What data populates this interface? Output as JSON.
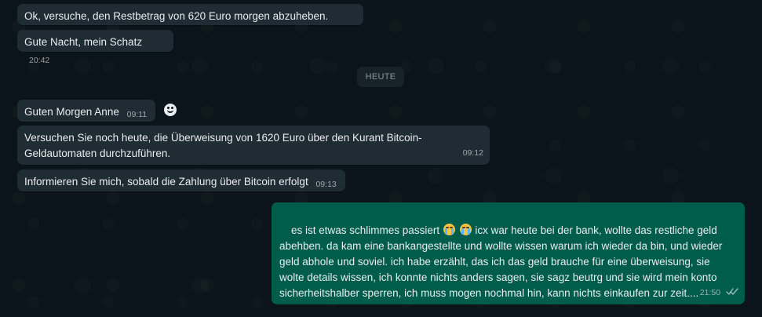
{
  "chat": {
    "day_separator": "HEUTE",
    "messages": [
      {
        "text": "Ok, versuche, den Restbetrag von 620 Euro morgen abzuheben.",
        "time": "20:42"
      },
      {
        "text": "Gute Nacht, mein Schatz",
        "time": "20:42"
      },
      {
        "text": "Guten Morgen Anne",
        "time": "09:11"
      },
      {
        "text": "Versuchen Sie noch heute, die Überweisung von 1620 Euro über den Kurant Bitcoin-\nGeldautomaten durchzuführen.",
        "time": "09:12"
      },
      {
        "text": "Informieren Sie mich, sobald die Zahlung über Bitcoin erfolgt",
        "time": "09:13"
      },
      {
        "text_before": "es ist etwas schlimmes passiert ",
        "text_after": " icx war heute bei der bank, wollte das restliche geld\nabehben. da kam eine bankangestellte und wollte wissen warum ich wieder da bin, und wieder\ngeld abhole und soviel. ich habe erzählt, das ich das geld brauche für eine überweisung, sie\nwolte details wissen, ich konnte nichts anders sagen, sie sagz beutrg und sie wird mein konto\nsicherheitshalber sperren, ich muss mogen nochmal hin, kann nichts einkaufen zur zeit....",
        "time": "21:50",
        "emoji": [
          "crying-face",
          "crying-face"
        ],
        "status_icon": "double-check-icon"
      }
    ]
  },
  "colors": {
    "background": "#0b141a",
    "incoming_bubble": "#202c33",
    "outgoing_bubble": "#005c4b",
    "day_pill": "#182229",
    "text": "#e9edef",
    "muted": "#8696a0"
  }
}
